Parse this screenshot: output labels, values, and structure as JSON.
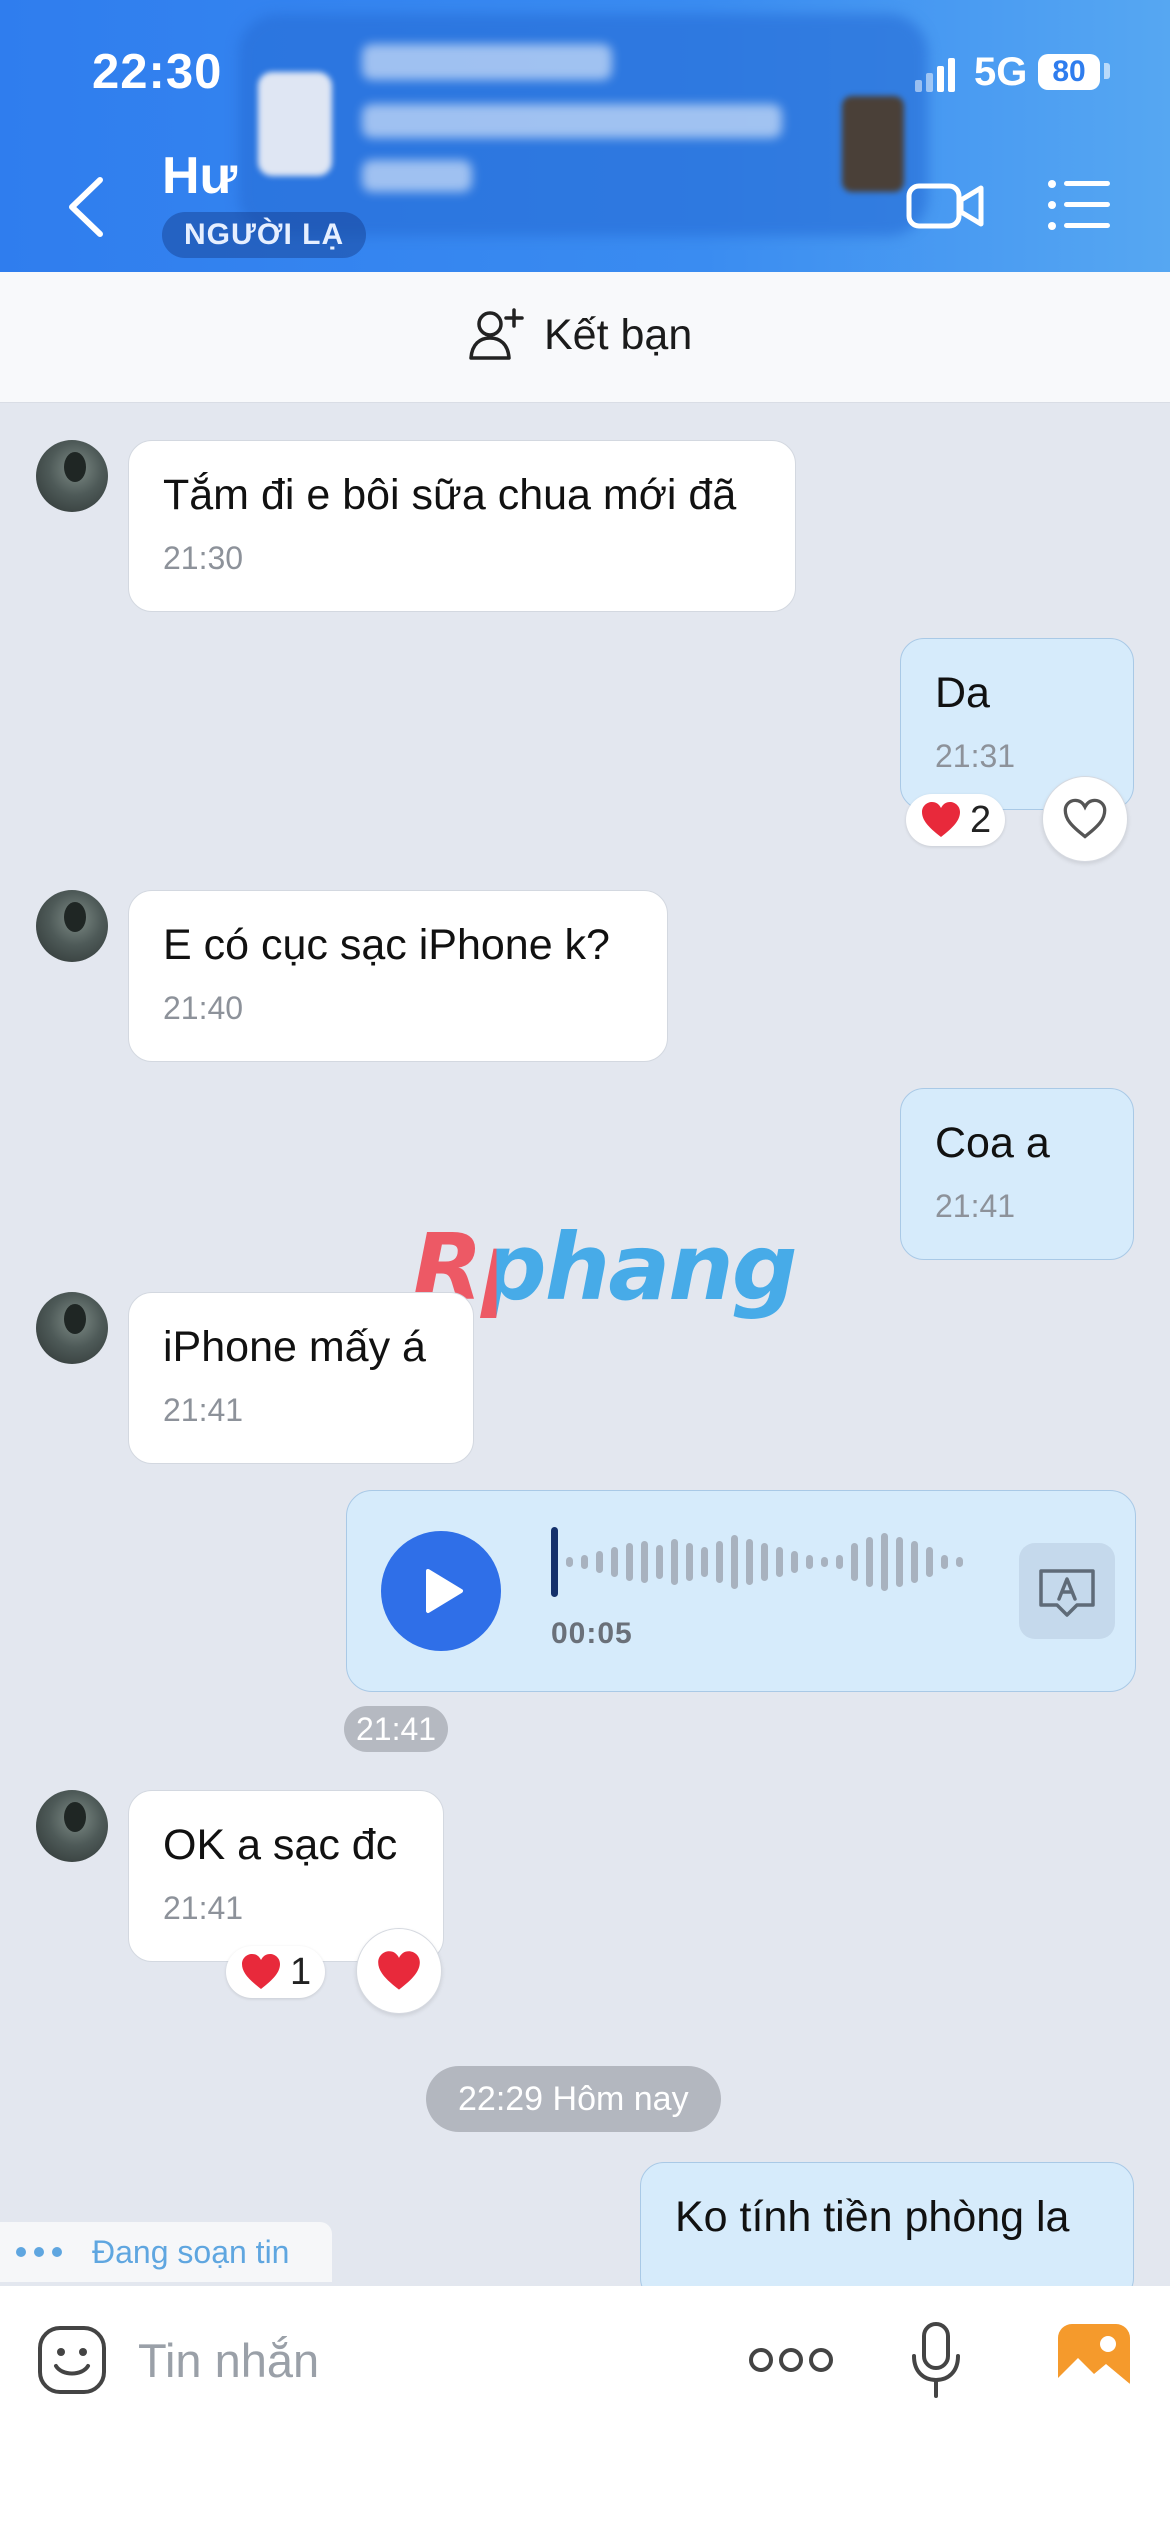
{
  "status_bar": {
    "time": "22:30",
    "network": "5G",
    "battery": "80"
  },
  "header": {
    "contact_name": "Hư",
    "badge": "NGƯỜI LẠ"
  },
  "friend_bar": {
    "label": "Kết bạn"
  },
  "messages": [
    {
      "side": "in",
      "text": "Tắm đi e bôi sữa chua mới đã",
      "time": "21:30"
    },
    {
      "side": "out",
      "text": "Da",
      "time": "21:31",
      "reaction": {
        "emoji": "heart",
        "count": "2"
      }
    },
    {
      "side": "in",
      "text": "E có cục sạc iPhone k?",
      "time": "21:40"
    },
    {
      "side": "out",
      "text": "Coa a",
      "time": "21:41"
    },
    {
      "side": "in",
      "text": "iPhone mấy á",
      "time": "21:41"
    },
    {
      "side": "out",
      "type": "voice",
      "duration": "00:05",
      "time": "21:41"
    },
    {
      "side": "in",
      "text": "OK a sạc đc",
      "time": "21:41",
      "reaction": {
        "emoji": "heart",
        "count": "1"
      }
    },
    {
      "side": "out",
      "text": "Ko tính tiền phòng la"
    }
  ],
  "date_separator": "22:29 Hôm nay",
  "typing_indicator": "Đang soạn tin",
  "watermark": "Rphang",
  "input": {
    "placeholder": "Tin nhắn"
  },
  "colors": {
    "header_start": "#2f7dee",
    "header_end": "#56a7f2",
    "out_bubble": "#d6ebfb",
    "play_button": "#2f6fe8",
    "heart": "#e8293b",
    "photo_button": "#f59a2c"
  }
}
